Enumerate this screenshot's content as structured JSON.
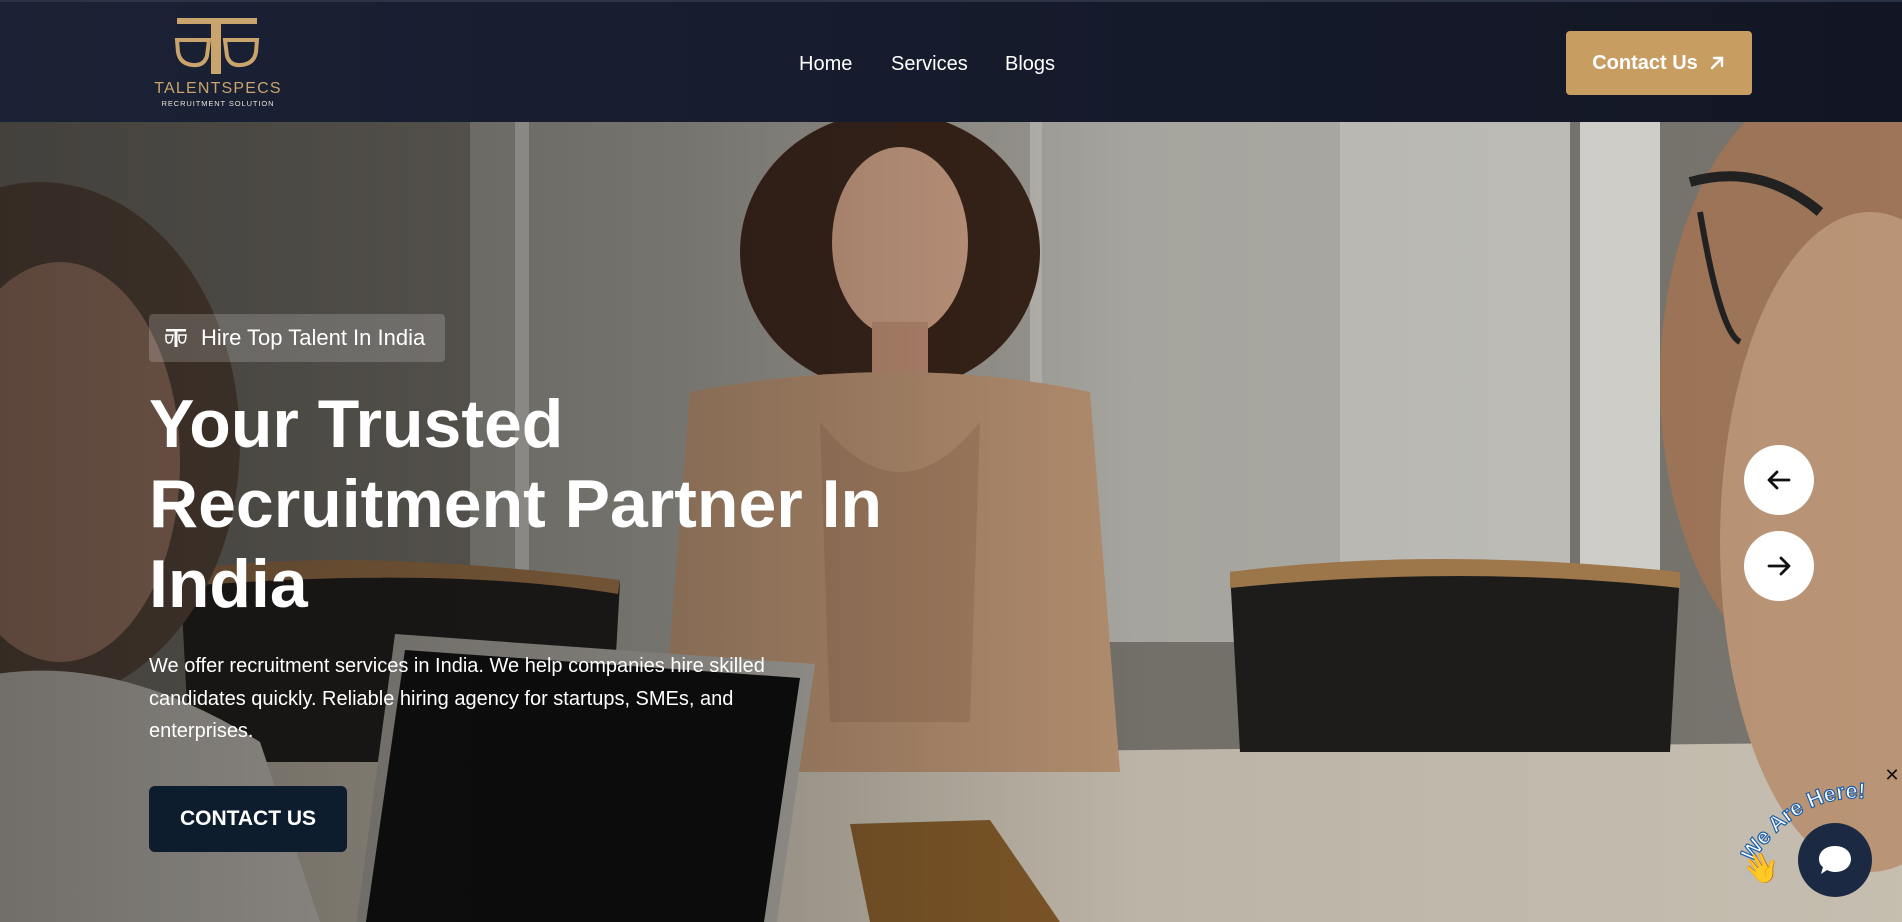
{
  "brand": {
    "name": "TALENTSPECS",
    "tagline": "RECRUITMENT SOLUTION",
    "accent": "#c79d62",
    "header_bg": "#161b2c"
  },
  "nav": {
    "items": [
      {
        "label": "Home"
      },
      {
        "label": "Services"
      },
      {
        "label": "Blogs"
      }
    ]
  },
  "header": {
    "contact_label": "Contact Us",
    "contact_icon": "arrow-up-right-icon"
  },
  "hero": {
    "badge": "Hire Top Talent In India",
    "title_lines": [
      "Your Trusted",
      "Recruitment Partner In",
      "India"
    ],
    "description_lines": [
      "We offer recruitment services in India. We help companies hire skilled",
      "candidates quickly. Reliable hiring agency for startups, SMEs, and",
      "enterprises."
    ],
    "cta_label": "CONTACT US",
    "cta_color": "#0e1d2e",
    "prev_icon": "arrow-left-icon",
    "next_icon": "arrow-right-icon"
  },
  "chat": {
    "label": "We Are Here!",
    "close": "✕",
    "icon": "chat-bubble-icon",
    "wave_icon": "waving-hand-icon"
  }
}
